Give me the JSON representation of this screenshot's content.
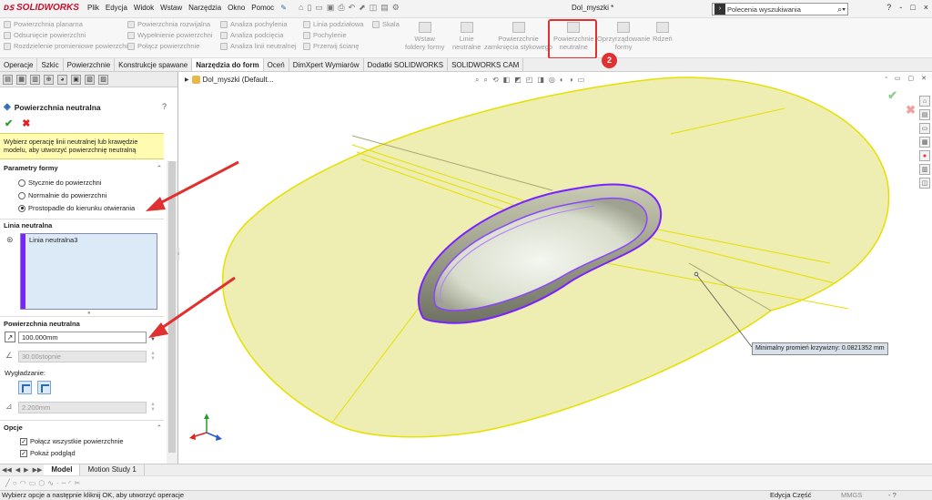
{
  "app": {
    "logo_text": "SOLIDWORKS",
    "menus": [
      "Plik",
      "Edycja",
      "Widok",
      "Wstaw",
      "Narzędzia",
      "Okno",
      "Pomoc"
    ],
    "document_title": "Dol_myszki *",
    "search_placeholder": "Polecenia wyszukiwania",
    "window_controls": [
      "?",
      "-",
      "□",
      "×"
    ]
  },
  "ribbon": {
    "col1": [
      "Powierzchnia planarna",
      "Odsunięcie powierzchni",
      "Rozdzielenie promieniowe powierzchni"
    ],
    "col2": [
      "Powierzchnia rozwijalna",
      "Wypełnienie powierzchni",
      "Połącz powierzchnie"
    ],
    "col3": [
      "Analiza pochylenia",
      "Analiza podcięcia",
      "Analiza linii neutralnej"
    ],
    "col4": [
      "Linia podziałowa",
      "Pochylenie",
      "Przerwij ścianę"
    ],
    "col5": [
      "Skala"
    ],
    "big_buttons": [
      {
        "line1": "Wstaw",
        "line2": "foldery formy"
      },
      {
        "line1": "Linie",
        "line2": "neutralne"
      },
      {
        "line1": "Powierzchnie",
        "line2": "zamknięcia stykowego"
      },
      {
        "line1": "Powierzchnie",
        "line2": "neutralne"
      },
      {
        "line1": "Oprzyrządowanie",
        "line2": "formy"
      },
      {
        "line1": "Rdzeń",
        "line2": ""
      }
    ],
    "highlight_badge": "2",
    "accent_color": "#e03030"
  },
  "command_tabs": [
    "Operacje",
    "Szkic",
    "Powierzchnie",
    "Konstrukcje spawane",
    "Narzędzia do form",
    "Oceń",
    "DimXpert Wymiarów",
    "Dodatki SOLIDWORKS",
    "SOLIDWORKS CAM"
  ],
  "active_command_tab": "Narzędzia do form",
  "panel": {
    "title": "Powierzchnia neutralna",
    "help": "?",
    "ok": "✔",
    "cancel": "✖",
    "message": "Wybierz operację linii neutralnej lub krawędzie modelu, aby utworzyć powierzchnię neutralną",
    "mold_params": {
      "header": "Parametry formy",
      "options": [
        "Stycznie do powierzchni",
        "Normalnie do powierzchni",
        "Prostopadle do kierunku otwierania"
      ],
      "selected_index": 2
    },
    "parting_line": {
      "header": "Linia neutralna",
      "items": [
        "Linia neutralna3"
      ]
    },
    "parting_surface": {
      "header": "Powierzchnia neutralna",
      "distance": "100.000mm",
      "angle": "30.00stopnie",
      "smoothing_label": "Wygładzanie:",
      "smoothing_value": "2.200mm"
    },
    "options": {
      "header": "Opcje",
      "checks": [
        {
          "label": "Połącz wszystkie powierzchnie",
          "checked": true
        },
        {
          "label": "Pokaż podgląd",
          "checked": true
        }
      ]
    }
  },
  "viewport": {
    "tree_label": "Dol_myszki  (Default...",
    "radius_label": "Minimalny promień krzywizny: 0.0821352 mm",
    "surface_color": "#eeedb2",
    "edge_color": "#e6e000",
    "parting_line_color": "#8a2be2"
  },
  "bottom_tabs": [
    "Model",
    "Motion Study 1"
  ],
  "active_bottom_tab": "Model",
  "status": {
    "message": "Wybierz opcje a następnie kliknij OK, aby utworzyć operacje",
    "mode": "Edycja Część",
    "units": "MMGS",
    "extra": "- ?"
  }
}
